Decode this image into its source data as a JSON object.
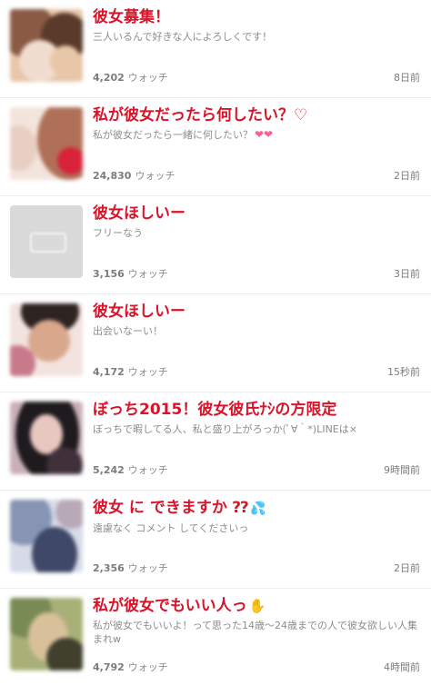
{
  "items": [
    {
      "title": "彼女募集！",
      "desc": "三人いるんで好きな人によろしくです！",
      "count": "4,202",
      "unit": "ウォッチ",
      "time": "8日前",
      "thumb_colors": [
        "#8a5a45",
        "#e8c6a8",
        "#5a3a2a",
        "#f0ddd0"
      ]
    },
    {
      "title": "私が彼女だったら何したい？♡",
      "desc": "私が彼女だったら一緒に何したい？",
      "desc_icon": "heart-pink-icon",
      "count": "24,830",
      "unit": "ウォッチ",
      "time": "2日前",
      "thumb_colors": [
        "#f3e4dc",
        "#b07058",
        "#d8233a",
        "#e9cfc2"
      ]
    },
    {
      "title": "彼女ほしいー",
      "desc": "フリーなう",
      "count": "3,156",
      "unit": "ウォッチ",
      "time": "3日前",
      "thumb_colors": [
        "#dadada"
      ]
    },
    {
      "title": "彼女ほしいー",
      "desc": "出会いなーい！",
      "count": "4,172",
      "unit": "ウォッチ",
      "time": "15秒前",
      "thumb_colors": [
        "#2d2320",
        "#d9a88c",
        "#c87a8a",
        "#f2e3df"
      ]
    },
    {
      "title": "ぼっち2015！彼女彼氏ﾅｼの方限定",
      "desc": "ぼっちで暇してる人、私と盛り上がろっか(ﾟ∀｀*)LINEは×",
      "count": "5,242",
      "unit": "ウォッチ",
      "time": "9時間前",
      "thumb_colors": [
        "#1e1a1e",
        "#e8c7c0",
        "#40303a",
        "#c9b0b8"
      ]
    },
    {
      "title": "彼女 に できますか ⁇",
      "title_icon": "sweat-drops-icon",
      "desc": "遠慮なく コメント してくださいっ",
      "count": "2,356",
      "unit": "ウォッチ",
      "time": "2日前",
      "thumb_colors": [
        "#8794b4",
        "#d7dbe8",
        "#3f4868",
        "#b8a8b8"
      ]
    },
    {
      "title": "私が彼女でもいい人っ",
      "title_icon": "raised-hand-icon",
      "desc": "私が彼女でもいいよ！って思った14歳〜24歳までの人で彼女欲しい人集まれw",
      "count": "4,792",
      "unit": "ウォッチ",
      "time": "4時間前",
      "thumb_colors": [
        "#7a8a55",
        "#d8c09a",
        "#40402c",
        "#a8b078"
      ]
    }
  ],
  "colors": {
    "title": "#d8142a",
    "meta": "#8c8c8c"
  }
}
